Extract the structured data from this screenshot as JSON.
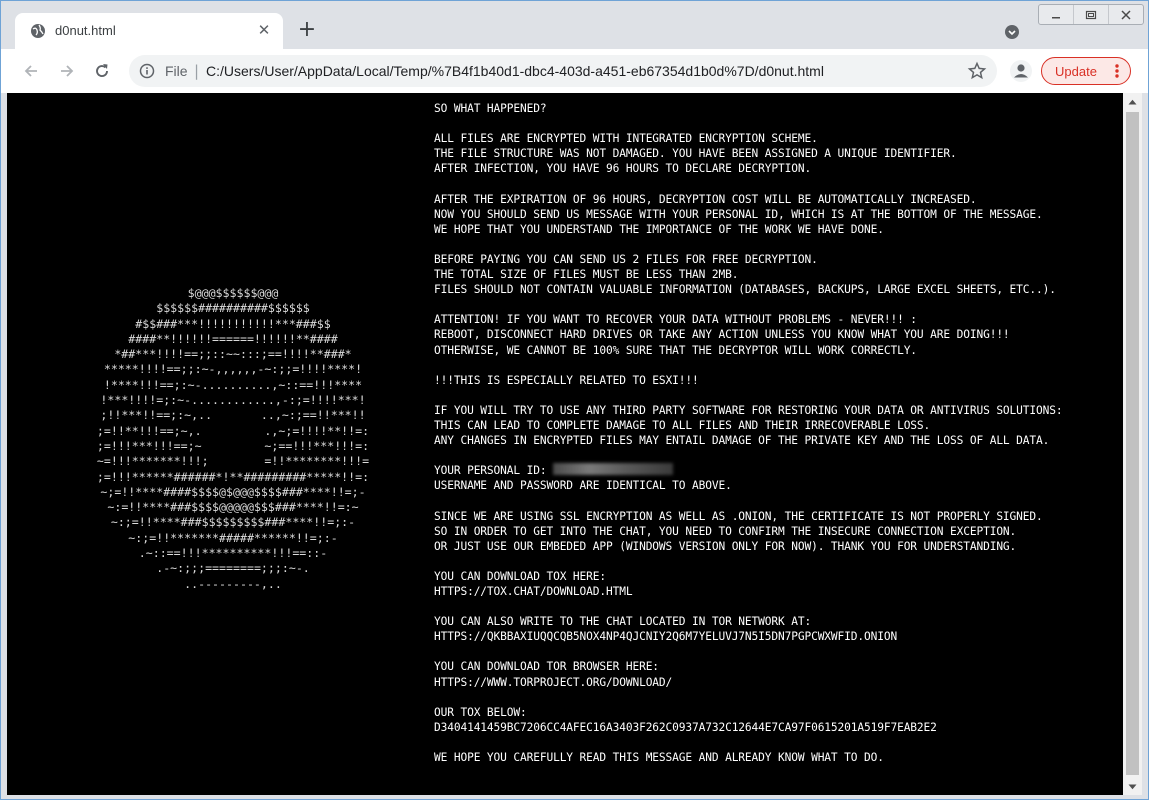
{
  "browser": {
    "tab_title": "d0nut.html",
    "scheme_label": "File",
    "url": "C:/Users/User/AppData/Local/Temp/%7B4f1b40d1-dbc4-403d-a451-eb67354d1b0d%7D/d0nut.html",
    "update_label": "Update"
  },
  "ascii_art": [
    "$@@@$$$$$$@@@",
    "$$$$$$##########$$$$$$",
    "#$$###***!!!!!!!!!!!***###$$",
    "####**!!!!!!======!!!!!!**####",
    "*##***!!!!==;;::~~:::;==!!!!**###*",
    "*****!!!!==;;:~-,,,,,,-~:;;=!!!!****!",
    "!****!!!==;:~-..........,~::==!!!****",
    "!***!!!!=;:~-............,-:;=!!!!***!",
    ";!!***!!==;:~,..       ..,~:;==!!***!!",
    ";=!!**!!!==;~,.         .,~;=!!!!**!!=:",
    ";=!!!***!!!==;~         ~;==!!!***!!!=:",
    "~=!!!*******!!!;        =!!********!!!=",
    ";=!!!******######*!**#########*****!!=:",
    "~;=!!****####$$$$@$@@@$$$$###****!!=;-",
    "~:=!!****###$$$$@@@@@$$$###****!!=:~",
    "~:;=!!****###$$$$$$$$$###****!!=;:-",
    "~:;=!!*******#####******!!=;:-",
    ".~::==!!!**********!!!==::-",
    ".-~:;;;========;;;:~-.",
    "..---------,.."
  ],
  "ransom_note": {
    "lines": [
      "SO WHAT HAPPENED?",
      "",
      "ALL FILES ARE ENCRYPTED WITH INTEGRATED ENCRYPTION SCHEME.",
      "THE FILE STRUCTURE WAS NOT DAMAGED. YOU HAVE BEEN ASSIGNED A UNIQUE IDENTIFIER.",
      "AFTER INFECTION, YOU HAVE 96 HOURS TO DECLARE DECRYPTION.",
      "",
      "AFTER THE EXPIRATION OF 96 HOURS, DECRYPTION COST WILL BE AUTOMATICALLY INCREASED.",
      "NOW YOU SHOULD SEND US MESSAGE WITH YOUR PERSONAL ID, WHICH IS AT THE BOTTOM OF THE MESSAGE.",
      "WE HOPE THAT YOU UNDERSTAND THE IMPORTANCE OF THE WORK WE HAVE DONE.",
      "",
      "BEFORE PAYING YOU CAN SEND US 2 FILES FOR FREE DECRYPTION.",
      "THE TOTAL SIZE OF FILES MUST BE LESS THAN 2MB.",
      "FILES SHOULD NOT CONTAIN VALUABLE INFORMATION (DATABASES, BACKUPS, LARGE EXCEL SHEETS, ETC..).",
      "",
      "ATTENTION! IF YOU WANT TO RECOVER YOUR DATA WITHOUT PROBLEMS - NEVER!!! :",
      "REBOOT, DISCONNECT HARD DRIVES OR TAKE ANY ACTION UNLESS YOU KNOW WHAT YOU ARE DOING!!!",
      "OTHERWISE, WE CANNOT BE 100% SURE THAT THE DECRYPTOR WILL WORK CORRECTLY.",
      "",
      "!!!THIS IS ESPECIALLY RELATED TO ESXI!!!",
      "",
      "IF YOU WILL TRY TO USE ANY THIRD PARTY SOFTWARE FOR RESTORING YOUR DATA OR ANTIVIRUS SOLUTIONS:",
      "THIS CAN LEAD TO COMPLETE DAMAGE TO ALL FILES AND THEIR IRRECOVERABLE LOSS.",
      "ANY CHANGES IN ENCRYPTED FILES MAY ENTAIL DAMAGE OF THE PRIVATE KEY AND THE LOSS OF ALL DATA.",
      "",
      "YOUR PERSONAL ID:",
      "USERNAME AND PASSWORD ARE IDENTICAL TO ABOVE.",
      "",
      "SINCE WE ARE USING SSL ENCRYPTION AS WELL AS .ONION, THE CERTIFICATE IS NOT PROPERLY SIGNED.",
      "SO IN ORDER TO GET INTO THE CHAT, YOU NEED TO CONFIRM THE INSECURE CONNECTION EXCEPTION.",
      "OR JUST USE OUR EMBEDED APP (WINDOWS VERSION ONLY FOR NOW). THANK YOU FOR UNDERSTANDING.",
      "",
      "YOU CAN DOWNLOAD TOX HERE:",
      "HTTPS://TOX.CHAT/DOWNLOAD.HTML",
      "",
      "YOU CAN ALSO WRITE TO THE CHAT LOCATED IN TOR NETWORK AT:",
      "HTTPS://QKBBAXIUQQCQB5NOX4NP4QJCNIY2Q6M7YELUVJ7N5I5DN7PGPCWXWFID.ONION",
      "",
      "YOU CAN DOWNLOAD TOR BROWSER HERE:",
      "HTTPS://WWW.TORPROJECT.ORG/DOWNLOAD/",
      "",
      "OUR TOX BELOW:",
      "D3404141459BC7206CC4AFEC16A3403F262C0937A732C12644E7CA97F0615201A519F7EAB2E2",
      "",
      "WE HOPE YOU CAREFULLY READ THIS MESSAGE AND ALREADY KNOW WHAT TO DO."
    ]
  },
  "icons": {
    "tab": "globe-icon",
    "close": "close-icon",
    "new_tab": "plus-icon",
    "back": "arrow-left-icon",
    "forward": "arrow-right-icon",
    "reload": "reload-icon",
    "info": "info-icon",
    "bookmark": "star-icon",
    "profile": "account-icon",
    "menu": "more-vertical-icon"
  },
  "colors": {
    "update_accent": "#d93025",
    "page_background": "#000000",
    "page_text": "#ffffff"
  }
}
